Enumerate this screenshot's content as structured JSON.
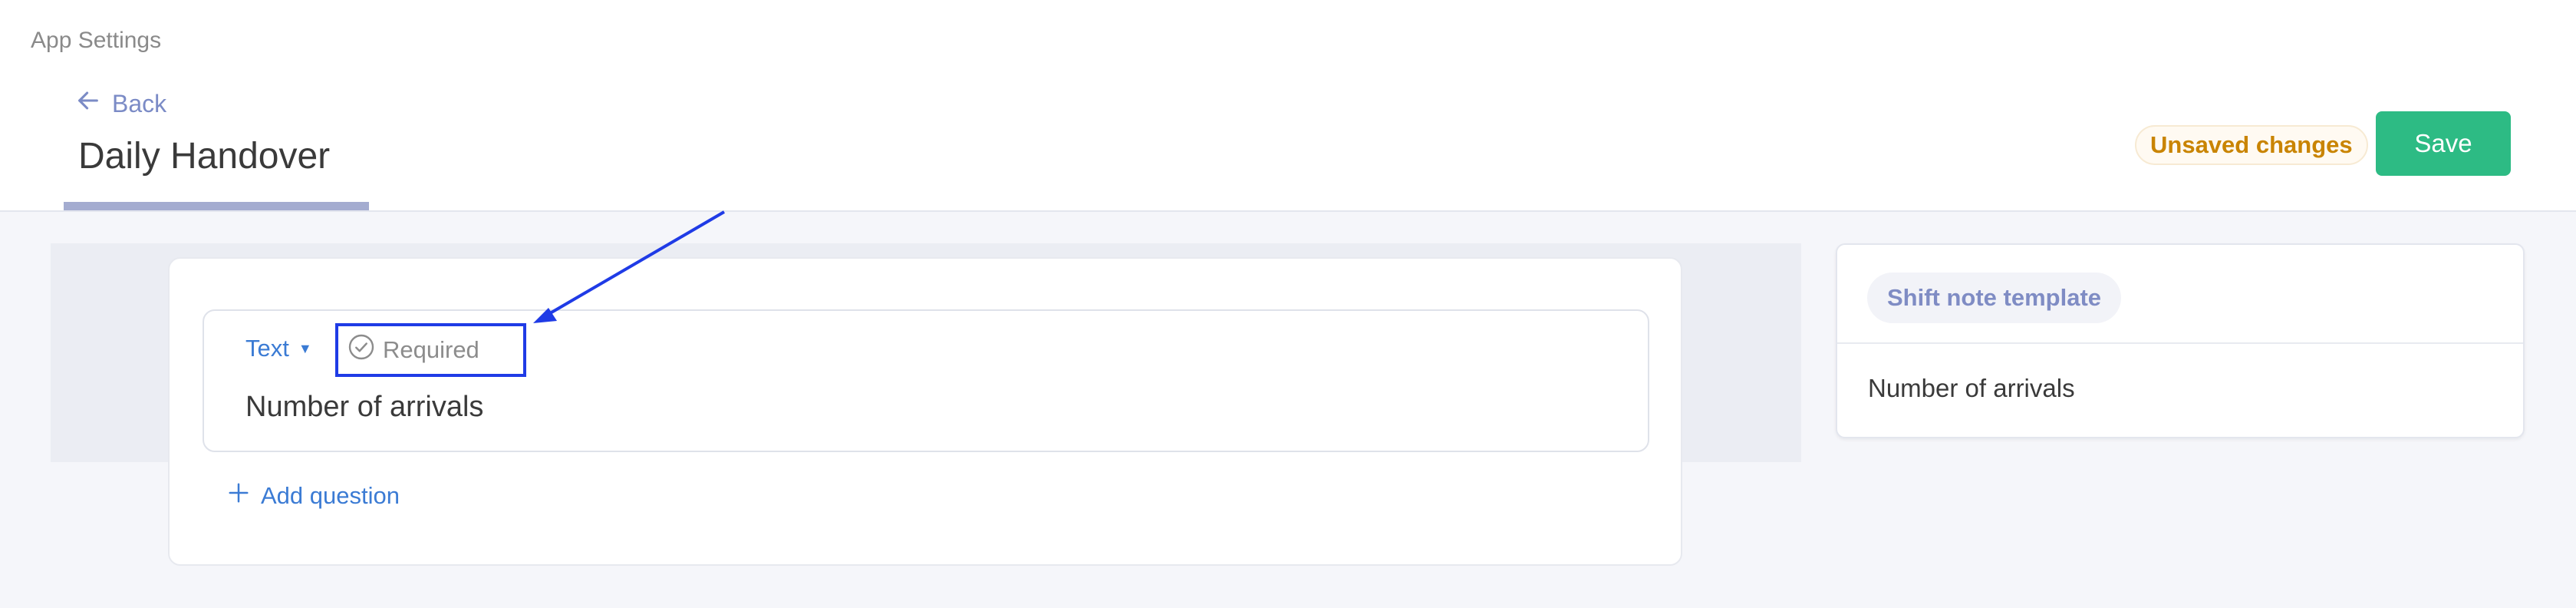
{
  "breadcrumb": "App Settings",
  "back_label": "Back",
  "page_title": "Daily Handover",
  "status_badge": "Unsaved changes",
  "save_label": "Save",
  "editor": {
    "question": {
      "type_label": "Text",
      "required_label": "Required",
      "text": "Number of arrivals"
    },
    "add_question_label": "Add question"
  },
  "preview": {
    "template_name": "Shift note template",
    "question_text": "Number of arrivals"
  },
  "colors": {
    "accent": "#2dbb84",
    "link": "#3b7bd4",
    "warning": "#c98400",
    "annotation": "#1f3be6"
  }
}
